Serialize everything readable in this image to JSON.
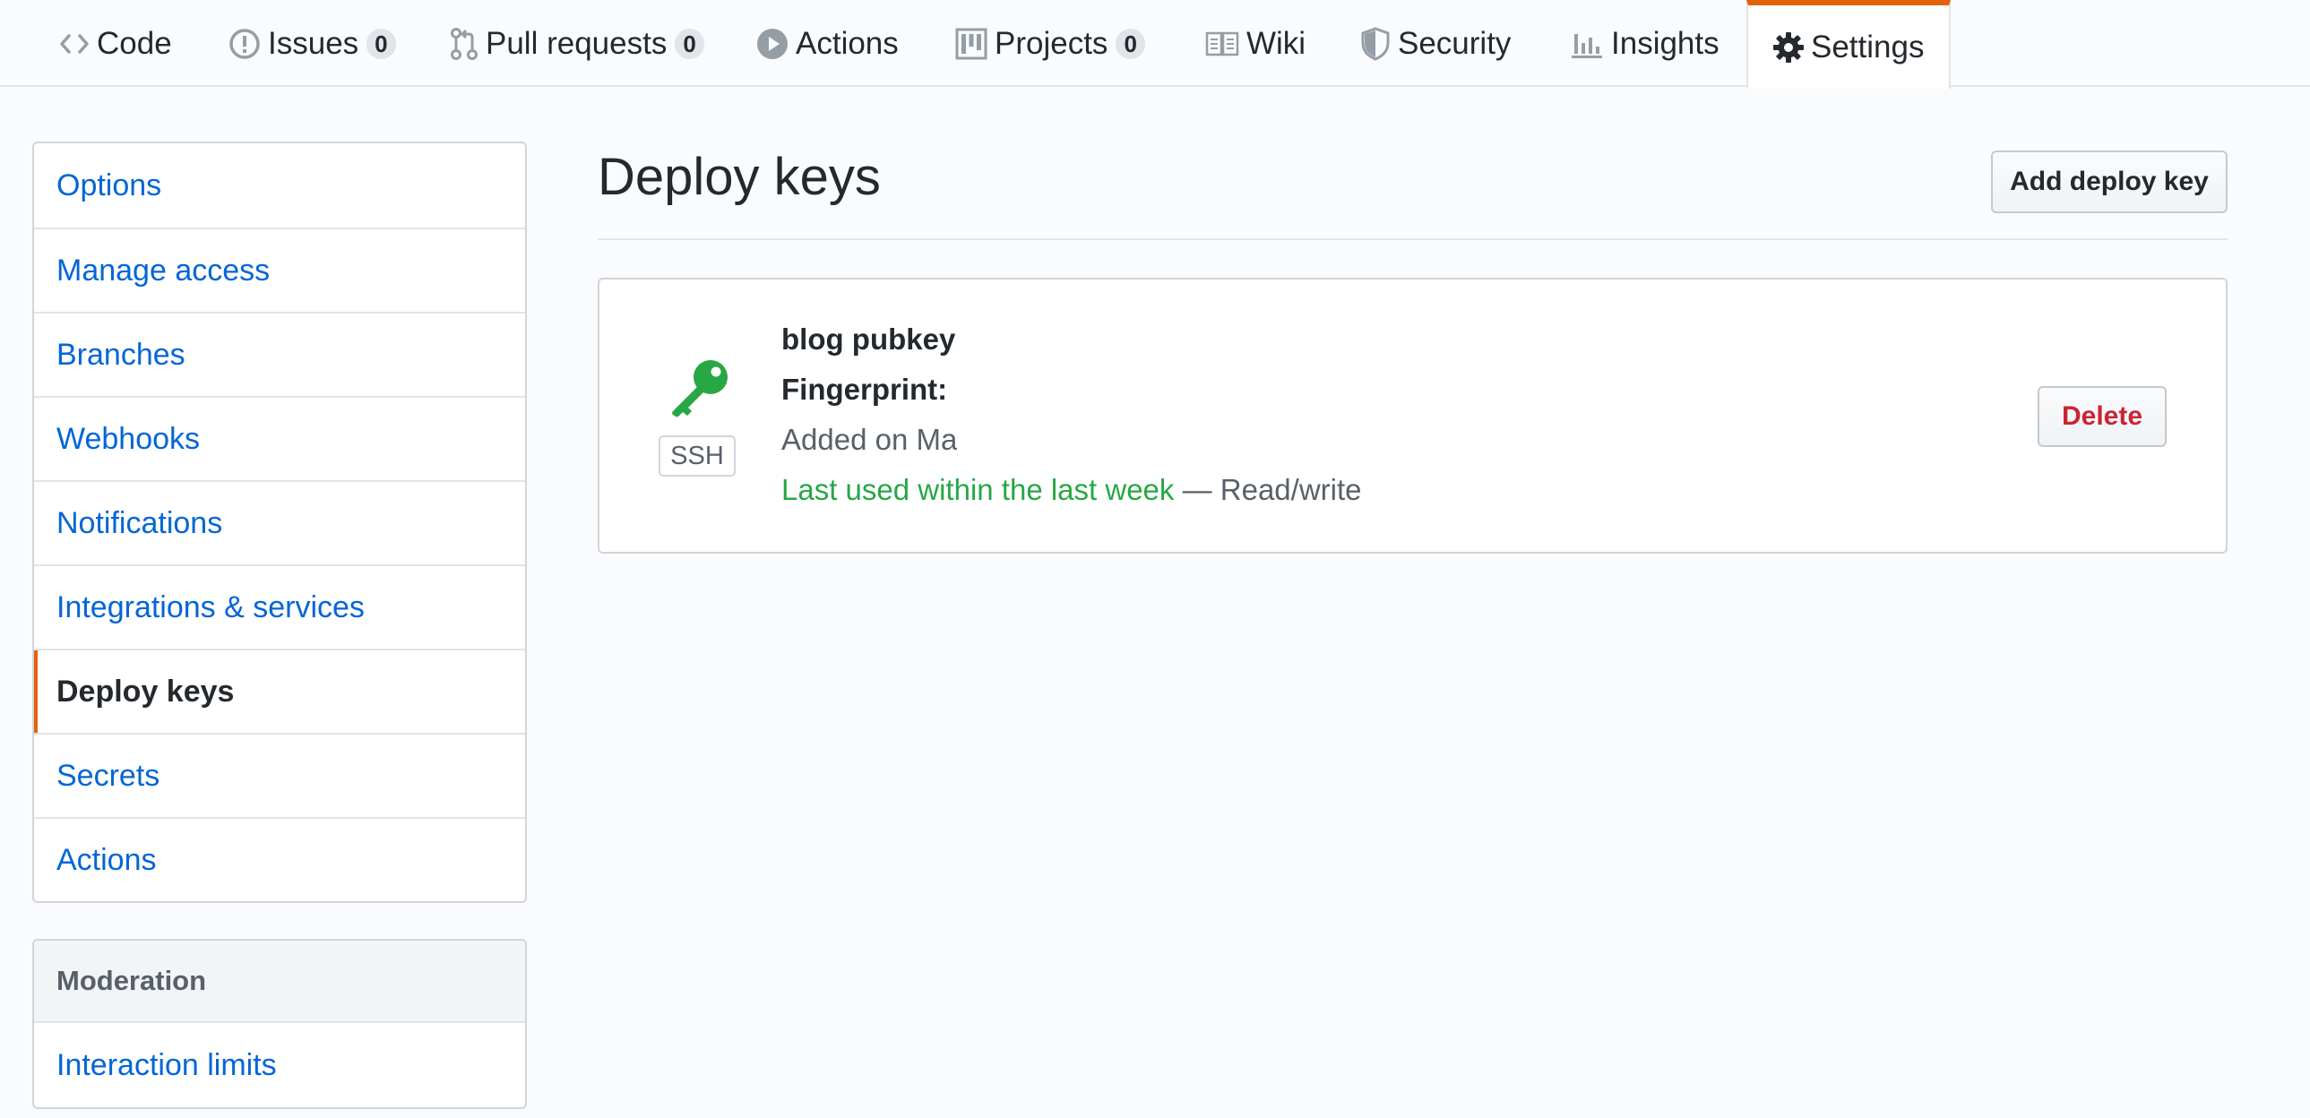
{
  "tabs": [
    {
      "label": "Code",
      "icon": "code-icon"
    },
    {
      "label": "Issues",
      "icon": "issue-opened-icon",
      "count": "0"
    },
    {
      "label": "Pull requests",
      "icon": "git-pull-request-icon",
      "count": "0"
    },
    {
      "label": "Actions",
      "icon": "play-icon"
    },
    {
      "label": "Projects",
      "icon": "project-icon",
      "count": "0"
    },
    {
      "label": "Wiki",
      "icon": "book-icon"
    },
    {
      "label": "Security",
      "icon": "shield-icon"
    },
    {
      "label": "Insights",
      "icon": "graph-icon"
    },
    {
      "label": "Settings",
      "icon": "gear-icon",
      "selected": true
    }
  ],
  "sidebar": {
    "items": [
      {
        "label": "Options"
      },
      {
        "label": "Manage access"
      },
      {
        "label": "Branches"
      },
      {
        "label": "Webhooks"
      },
      {
        "label": "Notifications"
      },
      {
        "label": "Integrations & services"
      },
      {
        "label": "Deploy keys",
        "selected": true
      },
      {
        "label": "Secrets"
      },
      {
        "label": "Actions"
      }
    ],
    "moderation": {
      "heading": "Moderation",
      "items": [
        {
          "label": "Interaction limits"
        }
      ]
    }
  },
  "main": {
    "title": "Deploy keys",
    "add_button": "Add deploy key",
    "key": {
      "title": "blog pubkey",
      "type_label": "SSH",
      "fingerprint_label": "Fingerprint:",
      "added": "Added on Ma",
      "last_used": "Last used within the last week",
      "access": " — Read/write",
      "delete_button": "Delete"
    }
  },
  "colors": {
    "accent": "#e36209",
    "link": "#0366d6",
    "success": "#28a745",
    "danger": "#cb2431"
  }
}
